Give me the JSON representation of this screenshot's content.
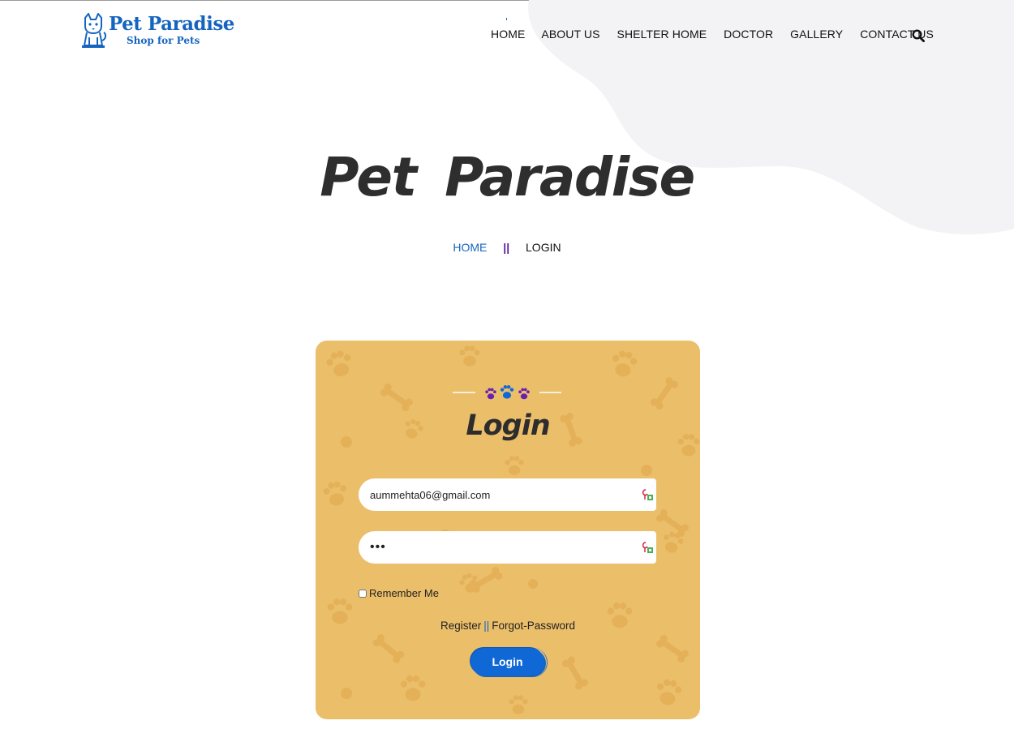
{
  "brand": {
    "title": "Pet Paradise",
    "subtitle": "Shop for Pets",
    "color": "#1565c0"
  },
  "nav": {
    "items": [
      "HOME",
      "ABOUT US",
      "SHELTER HOME",
      "DOCTOR",
      "GALLERY",
      "CONTACT US"
    ],
    "search_icon": "search-icon"
  },
  "hero": {
    "title": "Pet Paradise"
  },
  "breadcrumb": {
    "home": "HOME",
    "separator": "||",
    "current": "LOGIN"
  },
  "login_card": {
    "title": "Login",
    "background_color": "#ebbe6a",
    "email": {
      "value": "aummehta06@gmail.com"
    },
    "password": {
      "value": "•••"
    },
    "remember_label": "Remember Me",
    "register_link": "Register",
    "links_separator": "||",
    "forgot_link": "Forgot-Password",
    "submit_label": "Login",
    "button_color": "#1068d6"
  }
}
